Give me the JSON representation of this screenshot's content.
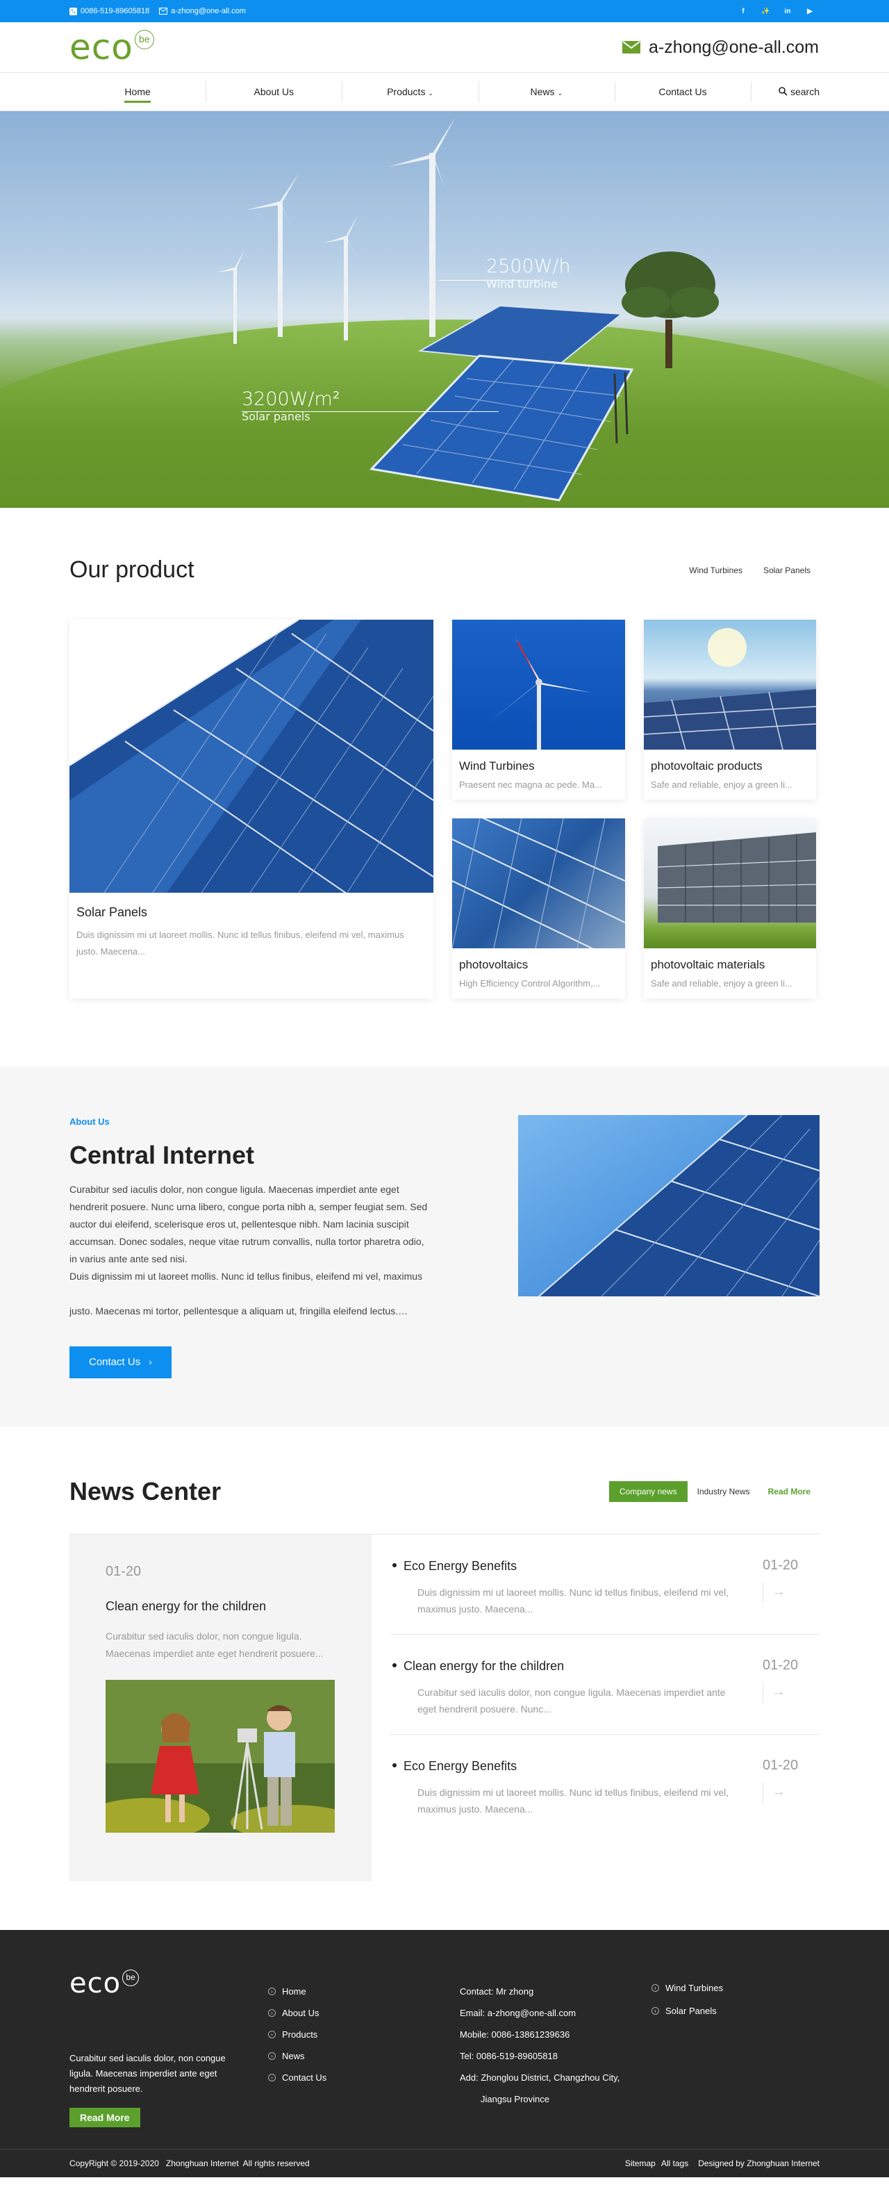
{
  "topbar": {
    "phone": "0086-519-89605818",
    "email": "a-zhong@one-all.com",
    "socials": [
      "facebook-icon",
      "twitter-icon",
      "linkedin-icon",
      "youtube-icon"
    ]
  },
  "header": {
    "logo_text": "eco",
    "logo_badge": "be",
    "email": "a-zhong@one-all.com"
  },
  "nav": {
    "items": [
      "Home",
      "About Us",
      "Products",
      "News",
      "Contact Us"
    ],
    "active": "Home",
    "search": "search"
  },
  "hero": {
    "wind_value": "2500W/h",
    "wind_label": "Wind turbine",
    "solar_value": "3200W/m²",
    "solar_label": "Solar panels"
  },
  "products": {
    "title": "Our product",
    "tabs": [
      "Wind Turbines",
      "Solar Panels"
    ],
    "items": [
      {
        "title": "Solar Panels",
        "desc": "Duis dignissim mi ut laoreet mollis. Nunc id tellus finibus, eleifend mi vel, maximus justo. Maecena..."
      },
      {
        "title": "Wind Turbines",
        "desc": "Praesent nec magna ac pede. Ma..."
      },
      {
        "title": "photovoltaic products",
        "desc": "Safe and reliable, enjoy a green li..."
      },
      {
        "title": "photovoltaics",
        "desc": "High Efficiency Control Algorithm,..."
      },
      {
        "title": "photovoltaic materials",
        "desc": "Safe and reliable, enjoy a green li..."
      }
    ]
  },
  "about": {
    "tag": "About Us",
    "title": "Central Internet",
    "para1": "Curabitur sed iaculis dolor, non congue ligula. Maecenas imperdiet ante eget hendrerit posuere. Nunc urna libero, congue porta nibh a, semper feugiat sem. Sed auctor dui eleifend, scelerisque eros ut, pellentesque nibh. Nam lacinia suscipit accumsan. Donec sodales, neque vitae rutrum convallis, nulla tortor pharetra odio, in varius ante ante sed nisi.",
    "para2": "Duis dignissim mi ut laoreet mollis. Nunc id tellus finibus, eleifend mi vel, maximus",
    "para3": "justo. Maecenas mi tortor, pellentesque a aliquam ut, fringilla eleifend lectus.…",
    "button": "Contact Us"
  },
  "news": {
    "title": "News Center",
    "tabs": [
      "Company news",
      "Industry News"
    ],
    "read_more": "Read More",
    "featured": {
      "date": "01-20",
      "title": "Clean energy for the children",
      "desc": "Curabitur sed iaculis dolor, non congue ligula. Maecenas imperdiet ante eget hendrerit posuere..."
    },
    "items": [
      {
        "title": "Eco Energy Benefits",
        "desc": "Duis dignissim mi ut laoreet mollis. Nunc id tellus finibus, eleifend mi vel, maximus justo. Maecena...",
        "date": "01-20"
      },
      {
        "title": "Clean energy for the children",
        "desc": "Curabitur sed iaculis dolor, non congue ligula. Maecenas imperdiet ante eget hendrerit posuere. Nunc...",
        "date": "01-20"
      },
      {
        "title": "Eco Energy Benefits",
        "desc": "Duis dignissim mi ut laoreet mollis. Nunc id tellus finibus, eleifend mi vel, maximus justo. Maecena...",
        "date": "01-20"
      }
    ]
  },
  "footer": {
    "logo_text": "eco",
    "logo_badge": "be",
    "about": "Curabitur sed iaculis dolor, non congue ligula. Maecenas imperdiet ante eget hendrerit posuere.",
    "read_more": "Read More",
    "links": [
      "Home",
      "About Us",
      "Products",
      "News",
      "Contact Us"
    ],
    "contact": {
      "contact": "Contact: Mr zhong",
      "email": "Email: a-zhong@one-all.com",
      "mobile": "Mobile: 0086-13861239636",
      "tel": "Tel: 0086-519-89605818",
      "add1": "Add: Zhonglou District, Changzhou City,",
      "add2": "Jiangsu Province"
    },
    "cats": [
      "Wind Turbines",
      "Solar Panels"
    ],
    "copyright": "CopyRight © 2019-2020   Zhonghuan Internet  All rights reserved",
    "sitemap": "Sitemap",
    "alltags": "All tags",
    "designed": "Designed by Zhonghuan Internet"
  },
  "colors": {
    "accent_blue": "#0d8ff0",
    "accent_green": "#6aa02c",
    "footer_bg": "#282828"
  }
}
